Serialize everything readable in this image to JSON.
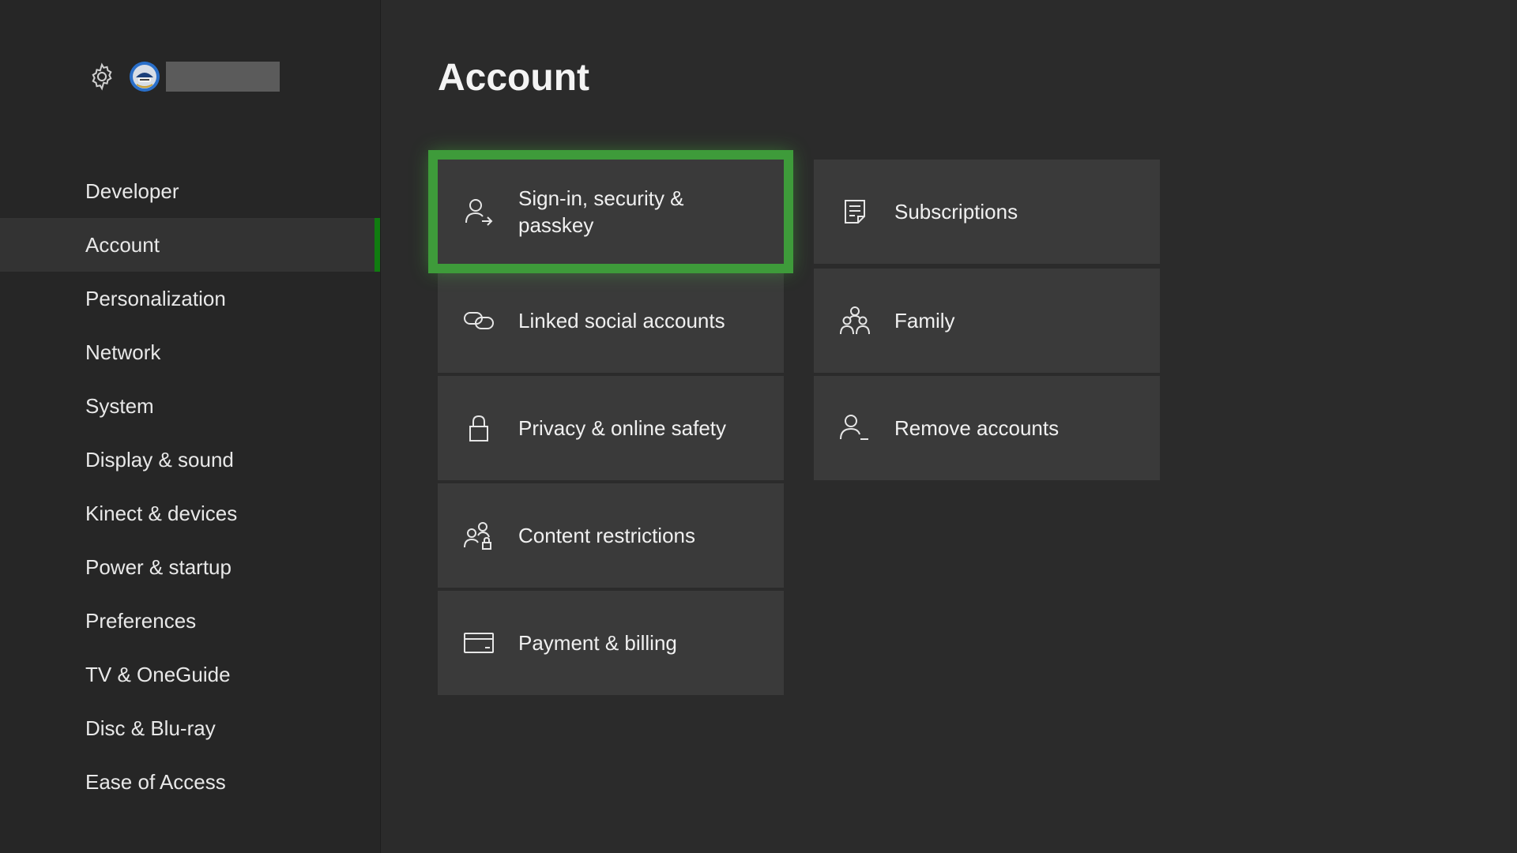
{
  "header": {
    "title": "Account"
  },
  "sidebar": {
    "items": [
      {
        "label": "Developer",
        "selected": false
      },
      {
        "label": "Account",
        "selected": true
      },
      {
        "label": "Personalization",
        "selected": false
      },
      {
        "label": "Network",
        "selected": false
      },
      {
        "label": "System",
        "selected": false
      },
      {
        "label": "Display & sound",
        "selected": false
      },
      {
        "label": "Kinect & devices",
        "selected": false
      },
      {
        "label": "Power & startup",
        "selected": false
      },
      {
        "label": "Preferences",
        "selected": false
      },
      {
        "label": "TV & OneGuide",
        "selected": false
      },
      {
        "label": "Disc & Blu-ray",
        "selected": false
      },
      {
        "label": "Ease of Access",
        "selected": false
      }
    ]
  },
  "tiles": {
    "signin": {
      "label": "Sign-in, security & passkey",
      "icon": "person-arrow-icon",
      "focused": true
    },
    "linked": {
      "label": "Linked social accounts",
      "icon": "link-icon"
    },
    "privacy": {
      "label": "Privacy & online safety",
      "icon": "lock-icon"
    },
    "content": {
      "label": "Content restrictions",
      "icon": "people-lock-icon"
    },
    "payment": {
      "label": "Payment & billing",
      "icon": "credit-card-icon"
    },
    "subscriptions": {
      "label": "Subscriptions",
      "icon": "document-list-icon"
    },
    "family": {
      "label": "Family",
      "icon": "family-icon"
    },
    "remove": {
      "label": "Remove accounts",
      "icon": "person-minus-icon"
    }
  },
  "colors": {
    "accent": "#107c10",
    "focus": "#3e9b3a",
    "background": "#2b2b2b",
    "tile": "#3a3a3a"
  }
}
